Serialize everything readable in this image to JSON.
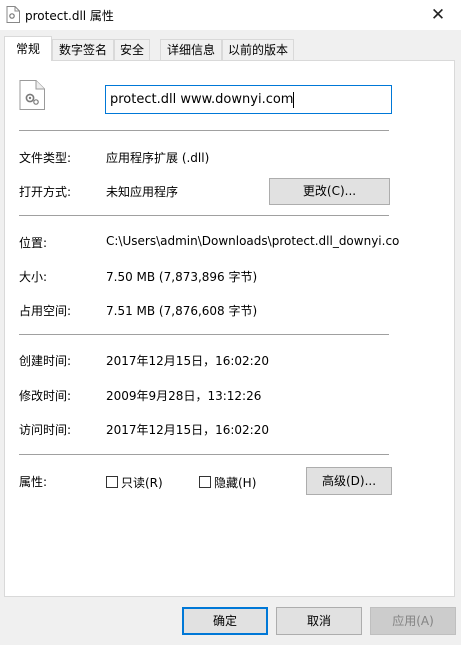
{
  "window": {
    "title": "protect.dll 属性"
  },
  "tabs": [
    {
      "label": "常规"
    },
    {
      "label": "数字签名"
    },
    {
      "label": "安全"
    },
    {
      "label": "详细信息"
    },
    {
      "label": "以前的版本"
    }
  ],
  "general": {
    "filename": "protect.dll www.downyi.com",
    "rows": {
      "type": {
        "label": "文件类型:",
        "value": "应用程序扩展 (.dll)"
      },
      "opens": {
        "label": "打开方式:",
        "value": "未知应用程序"
      },
      "location": {
        "label": "位置:",
        "value": "C:\\Users\\admin\\Downloads\\protect.dll_downyi.co"
      },
      "size": {
        "label": "大小:",
        "value": "7.50 MB (7,873,896 字节)"
      },
      "disk_size": {
        "label": "占用空间:",
        "value": "7.51 MB (7,876,608 字节)"
      },
      "created": {
        "label": "创建时间:",
        "value": "2017年12月15日，16:02:20"
      },
      "modified": {
        "label": "修改时间:",
        "value": "2009年9月28日，13:12:26"
      },
      "accessed": {
        "label": "访问时间:",
        "value": "2017年12月15日，16:02:20"
      }
    },
    "change_button": "更改(C)...",
    "attributes_label": "属性:",
    "readonly_label": "只读(R)",
    "hidden_label": "隐藏(H)",
    "advanced_button": "高级(D)..."
  },
  "footer": {
    "ok": "确定",
    "cancel": "取消",
    "apply": "应用(A)"
  },
  "icons": {
    "title": "dll-file-icon",
    "file": "dll-file-icon",
    "close": "close-icon"
  }
}
